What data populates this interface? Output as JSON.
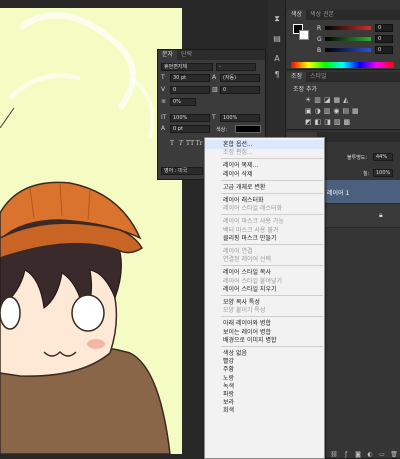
{
  "color_panel": {
    "tabs": [
      "색상",
      "색상 견본"
    ],
    "sliders": [
      {
        "letter": "R",
        "value": "0",
        "color": "#d03030"
      },
      {
        "letter": "G",
        "value": "0",
        "color": "#2fae2f"
      },
      {
        "letter": "B",
        "value": "0",
        "color": "#3050d0"
      }
    ]
  },
  "adjust_panel": {
    "tabs": [
      "조정",
      "스타일"
    ],
    "subtitle": "조정 추가"
  },
  "char_panel": {
    "tabs": [
      "문자",
      "단락"
    ],
    "font_family": "휴먼편지체",
    "font_style": "-",
    "size": "30 pt",
    "leading": "(자동)",
    "kerning": "0",
    "tracking": "0",
    "scale_v": "0%",
    "scale_h_1": "100%",
    "scale_h_2": "100%",
    "baseline": "0 pt",
    "color_label": "색상:",
    "style_buttons": [
      "T",
      "T",
      "TT",
      "Tr",
      "T¹",
      "T,",
      "T",
      "T"
    ],
    "language": "영어 : 미국",
    "aa": "aa"
  },
  "layers": {
    "opacity_label": "불투명도:",
    "opacity_value": "44%",
    "fill_label": "칠:",
    "fill_value": "100%",
    "selected_layer": "레이어 1"
  },
  "context_menu": {
    "items": [
      {
        "label": "혼합 옵션...",
        "disabled": false,
        "hover": true
      },
      {
        "label": "조정 편집...",
        "disabled": true
      },
      {
        "sep": true
      },
      {
        "label": "레이어 복제...",
        "disabled": false
      },
      {
        "label": "레이어 삭제",
        "disabled": false
      },
      {
        "sep": true
      },
      {
        "label": "고급 개체로 변환",
        "disabled": false
      },
      {
        "sep": true
      },
      {
        "label": "레이어 래스터화",
        "disabled": false
      },
      {
        "label": "레이어 스타일 래스터화",
        "disabled": true
      },
      {
        "sep": true
      },
      {
        "label": "레이어 마스크 사용 가능",
        "disabled": true
      },
      {
        "label": "벡터 마스크 사용 불가",
        "disabled": true
      },
      {
        "label": "클리핑 마스크 만들기",
        "disabled": false
      },
      {
        "sep": true
      },
      {
        "label": "레이어 연결",
        "disabled": true
      },
      {
        "label": "연결된 레이어 선택",
        "disabled": true
      },
      {
        "sep": true
      },
      {
        "label": "레이어 스타일 복사",
        "disabled": false
      },
      {
        "label": "레이어 스타일 붙여넣기",
        "disabled": true
      },
      {
        "label": "레이어 스타일 지우기",
        "disabled": false
      },
      {
        "sep": true
      },
      {
        "label": "모양 복사 특성",
        "disabled": false
      },
      {
        "label": "모양 붙이기 특성",
        "disabled": true
      },
      {
        "sep": true
      },
      {
        "label": "아래 레이어와 병합",
        "disabled": false
      },
      {
        "label": "보이는 레이어 병합",
        "disabled": false
      },
      {
        "label": "배경으로 이미지 병합",
        "disabled": false
      },
      {
        "sep": true
      },
      {
        "label": "색상 없음",
        "disabled": false
      },
      {
        "label": "빨강",
        "disabled": false
      },
      {
        "label": "주황",
        "disabled": false
      },
      {
        "label": "노랑",
        "disabled": false
      },
      {
        "label": "녹색",
        "disabled": false
      },
      {
        "label": "파랑",
        "disabled": false
      },
      {
        "label": "보라",
        "disabled": false
      },
      {
        "label": "회색",
        "disabled": false
      }
    ]
  }
}
